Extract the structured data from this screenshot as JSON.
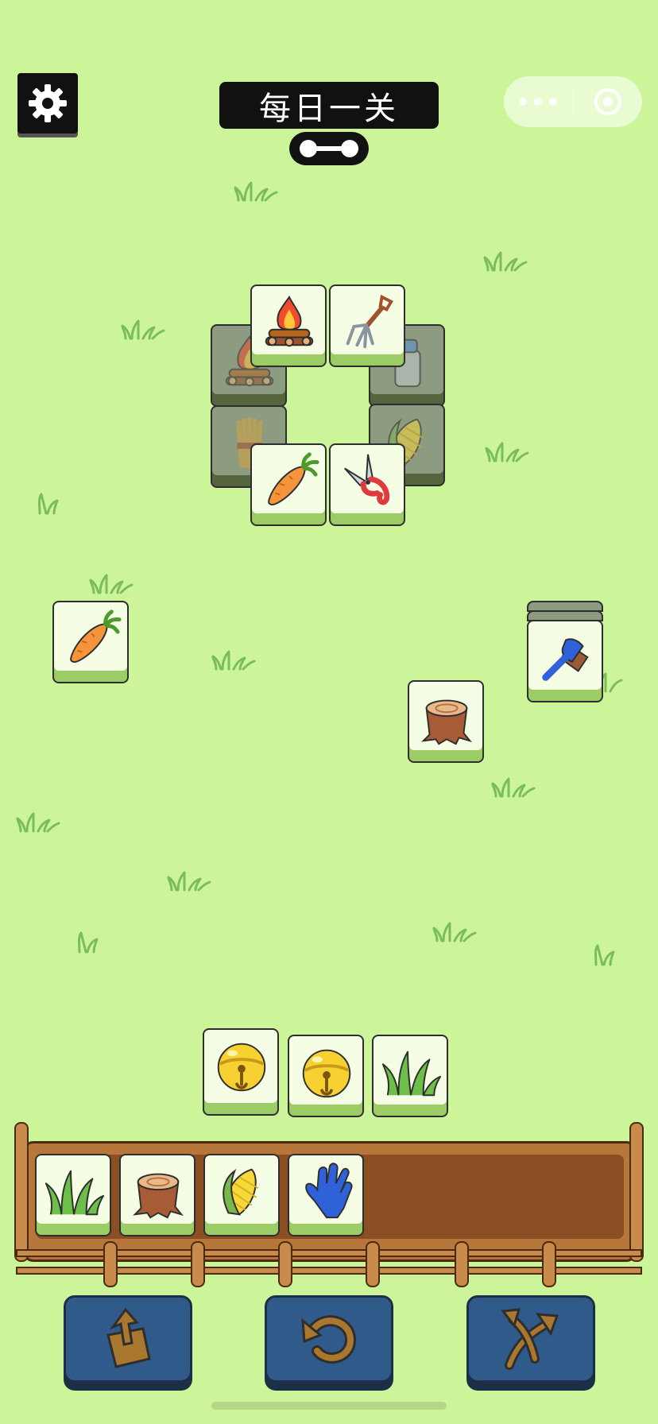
{
  "header": {
    "title": "每日一关",
    "settings_icon": "gear-icon",
    "capsule": {
      "more_label": "•••",
      "close_icon": "target-circle-icon"
    }
  },
  "board": {
    "tiles": [
      {
        "item": "campfire",
        "state": "locked"
      },
      {
        "item": "milk-can",
        "state": "locked"
      },
      {
        "item": "wheat-bundle",
        "state": "locked"
      },
      {
        "item": "corn",
        "state": "locked"
      },
      {
        "item": "campfire",
        "state": "free"
      },
      {
        "item": "pitchfork",
        "state": "free"
      },
      {
        "item": "carrot",
        "state": "free"
      },
      {
        "item": "pruning-shears",
        "state": "free"
      },
      {
        "item": "carrot",
        "state": "free"
      },
      {
        "item": "tree-stump",
        "state": "free"
      },
      {
        "item": "blue-brush",
        "state": "free"
      },
      {
        "item": "golden-bell",
        "state": "free"
      },
      {
        "item": "golden-bell",
        "state": "free"
      },
      {
        "item": "grass-tuft",
        "state": "free"
      }
    ]
  },
  "tray": {
    "capacity": 7,
    "slots": [
      "grass-tuft",
      "tree-stump",
      "corn",
      "blue-glove"
    ]
  },
  "tools": [
    {
      "name": "move-out",
      "icon": "box-arrow-up-icon"
    },
    {
      "name": "undo",
      "icon": "undo-arrow-icon"
    },
    {
      "name": "shuffle",
      "icon": "shuffle-arrows-icon"
    }
  ],
  "colors": {
    "background": "#ccf59a",
    "tile_face": "#f5fde4",
    "tile_base": "#9ccc65",
    "button": "#2f5a8a",
    "tray": "#b7773a"
  }
}
